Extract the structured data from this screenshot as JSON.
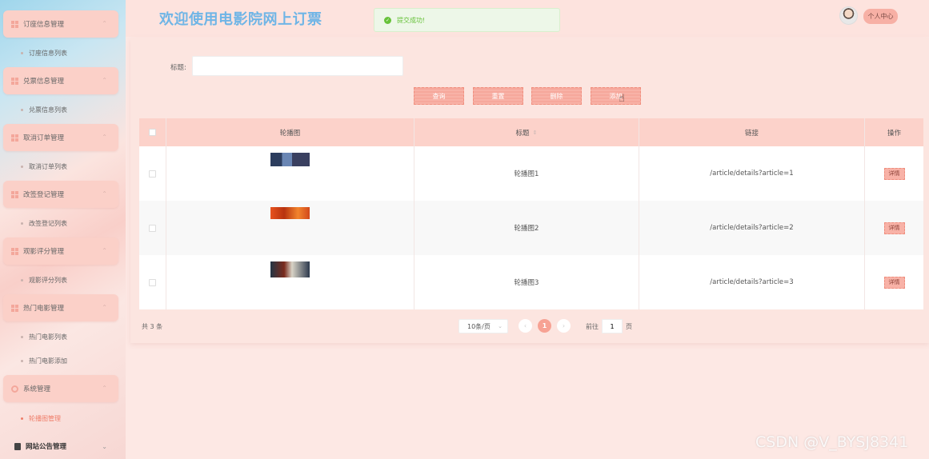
{
  "sidebar": {
    "groups": [
      {
        "label": "订座信息管理",
        "items": [
          "订座信息列表"
        ]
      },
      {
        "label": "兑票信息管理",
        "items": [
          "兑票信息列表"
        ]
      },
      {
        "label": "取消订单管理",
        "items": [
          "取消订单列表"
        ]
      },
      {
        "label": "改签登记管理",
        "items": [
          "改签登记列表"
        ]
      },
      {
        "label": "观影评分管理",
        "items": [
          "观影评分列表"
        ]
      },
      {
        "label": "热门电影管理",
        "items": [
          "热门电影列表",
          "热门电影添加"
        ]
      },
      {
        "label": "系统管理",
        "items": [
          "轮播图管理"
        ]
      }
    ],
    "active_item": "轮播图管理",
    "last_group": "网站公告管理"
  },
  "header": {
    "title": "欢迎使用电影院网上订票",
    "toast": "提交成功!",
    "user_center": "个人中心"
  },
  "search": {
    "label": "标题:",
    "value": "",
    "placeholder": ""
  },
  "buttons": {
    "query": "查询",
    "reset": "重置",
    "delete": "删除",
    "add": "添加"
  },
  "table": {
    "headers": [
      "轮播图",
      "标题",
      "链接",
      "操作"
    ],
    "rows": [
      {
        "title": "轮播图1",
        "link": "/article/details?article=1",
        "action": "详情"
      },
      {
        "title": "轮播图2",
        "link": "/article/details?article=2",
        "action": "详情"
      },
      {
        "title": "轮播图3",
        "link": "/article/details?article=3",
        "action": "详情"
      }
    ]
  },
  "pagination": {
    "total": "共 3 条",
    "page_size": "10条/页",
    "current_page": "1",
    "goto_prefix": "前往",
    "goto_value": "1",
    "goto_suffix": "页"
  },
  "watermark": "CSDN @V_BYSJ8341",
  "colors": {
    "accent": "#f7a294",
    "title": "#6fb5e6",
    "success": "#67c23a"
  }
}
